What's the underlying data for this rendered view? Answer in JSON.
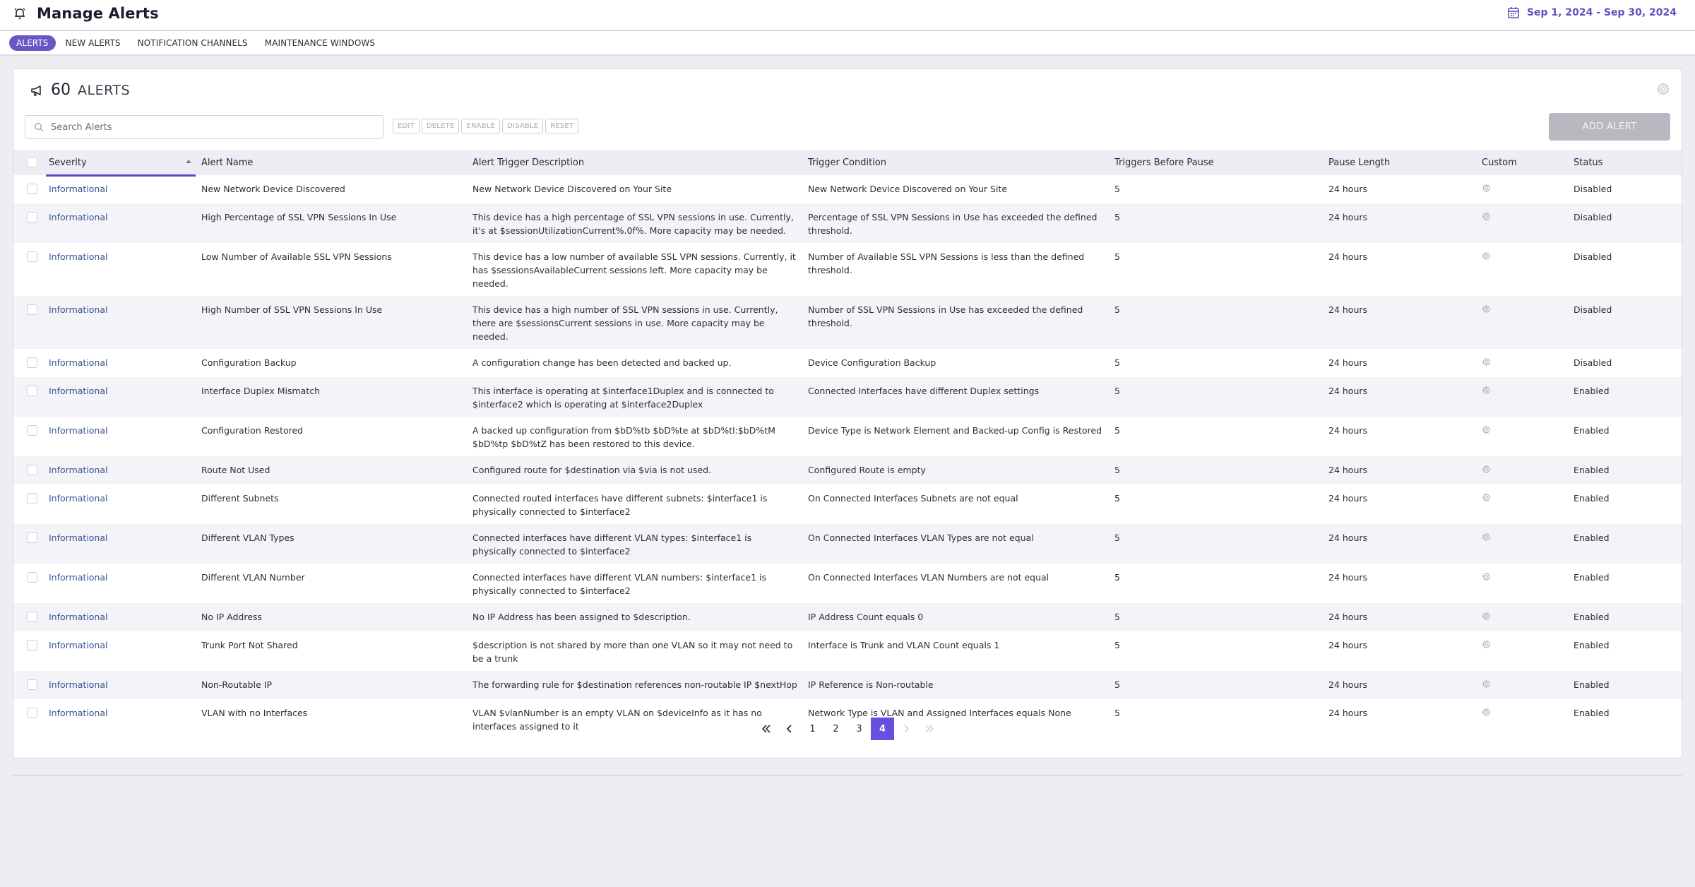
{
  "header": {
    "title": "Manage Alerts",
    "title_icon": "bell-icon",
    "date_range": "Sep 1, 2024 - Sep 30, 2024",
    "date_icon": "calendar-icon"
  },
  "tabs": [
    {
      "label": "ALERTS",
      "active": true
    },
    {
      "label": "NEW ALERTS",
      "active": false
    },
    {
      "label": "NOTIFICATION CHANNELS",
      "active": false
    },
    {
      "label": "MAINTENANCE WINDOWS",
      "active": false
    }
  ],
  "summary": {
    "count": "60",
    "label": "ALERTS",
    "icon": "megaphone-icon"
  },
  "search": {
    "placeholder": "Search Alerts",
    "value": ""
  },
  "actions": {
    "edit": "EDIT",
    "delete": "DELETE",
    "enable": "ENABLE",
    "disable": "DISABLE",
    "reset": "RESET",
    "add_alert": "ADD ALERT"
  },
  "table": {
    "columns": [
      "Severity",
      "Alert Name",
      "Alert Trigger Description",
      "Trigger Condition",
      "Triggers Before Pause",
      "Pause Length",
      "Custom",
      "Status"
    ],
    "sorted_by": "Severity",
    "sort_direction": "ascending",
    "rows": [
      {
        "severity": "Informational",
        "name": "New Network Device Discovered",
        "description": "New Network Device Discovered on Your Site",
        "condition": "New Network Device Discovered on Your Site",
        "triggers": "5",
        "pause": "24 hours",
        "custom": "gear-icon",
        "status": "Disabled"
      },
      {
        "severity": "Informational",
        "name": "High Percentage of SSL VPN Sessions In Use",
        "description": "This device has a high percentage of SSL VPN sessions in use. Currently, it's at $sessionUtilizationCurrent%.0f%. More capacity may be needed.",
        "condition": "Percentage of SSL VPN Sessions in Use has exceeded the defined threshold.",
        "triggers": "5",
        "pause": "24 hours",
        "custom": "gear-icon",
        "status": "Disabled"
      },
      {
        "severity": "Informational",
        "name": "Low Number of Available SSL VPN Sessions",
        "description": "This device has a low number of available SSL VPN sessions. Currently, it has $sessionsAvailableCurrent sessions left. More capacity may be needed.",
        "condition": "Number of Available SSL VPN Sessions is less than the defined threshold.",
        "triggers": "5",
        "pause": "24 hours",
        "custom": "gear-icon",
        "status": "Disabled"
      },
      {
        "severity": "Informational",
        "name": "High Number of SSL VPN Sessions In Use",
        "description": "This device has a high number of SSL VPN sessions in use. Currently, there are $sessionsCurrent sessions in use. More capacity may be needed.",
        "condition": "Number of SSL VPN Sessions in Use has exceeded the defined threshold.",
        "triggers": "5",
        "pause": "24 hours",
        "custom": "gear-icon",
        "status": "Disabled"
      },
      {
        "severity": "Informational",
        "name": "Configuration Backup",
        "description": "A configuration change has been detected and backed up.",
        "condition": "Device Configuration Backup",
        "triggers": "5",
        "pause": "24 hours",
        "custom": "gear-icon",
        "status": "Disabled"
      },
      {
        "severity": "Informational",
        "name": "Interface Duplex Mismatch",
        "description": "This interface is operating at $interface1Duplex and is connected to $interface2 which is operating at $interface2Duplex",
        "condition": "Connected Interfaces have different Duplex settings",
        "triggers": "5",
        "pause": "24 hours",
        "custom": "gear-icon",
        "status": "Enabled"
      },
      {
        "severity": "Informational",
        "name": "Configuration Restored",
        "description": "A backed up configuration from $bD%tb $bD%te at $bD%tl:$bD%tM $bD%tp $bD%tZ has been restored to this device.",
        "condition": "Device Type is Network Element and Backed-up Config is Restored",
        "triggers": "5",
        "pause": "24 hours",
        "custom": "gear-icon",
        "status": "Enabled"
      },
      {
        "severity": "Informational",
        "name": "Route Not Used",
        "description": "Configured route for $destination via $via is not used.",
        "condition": "Configured Route is empty",
        "triggers": "5",
        "pause": "24 hours",
        "custom": "gear-icon",
        "status": "Enabled"
      },
      {
        "severity": "Informational",
        "name": "Different Subnets",
        "description": "Connected routed interfaces have different subnets: $interface1 is physically connected to $interface2",
        "condition": "On Connected Interfaces Subnets are not equal",
        "triggers": "5",
        "pause": "24 hours",
        "custom": "gear-icon",
        "status": "Enabled"
      },
      {
        "severity": "Informational",
        "name": "Different VLAN Types",
        "description": "Connected interfaces have different VLAN types: $interface1 is physically connected to $interface2",
        "condition": "On Connected Interfaces VLAN Types are not equal",
        "triggers": "5",
        "pause": "24 hours",
        "custom": "gear-icon",
        "status": "Enabled"
      },
      {
        "severity": "Informational",
        "name": "Different VLAN Number",
        "description": "Connected interfaces have different VLAN numbers: $interface1 is physically connected to $interface2",
        "condition": "On Connected Interfaces VLAN Numbers are not equal",
        "triggers": "5",
        "pause": "24 hours",
        "custom": "gear-icon",
        "status": "Enabled"
      },
      {
        "severity": "Informational",
        "name": "No IP Address",
        "description": "No IP Address has been assigned to $description.",
        "condition": "IP Address Count equals 0",
        "triggers": "5",
        "pause": "24 hours",
        "custom": "gear-icon",
        "status": "Enabled"
      },
      {
        "severity": "Informational",
        "name": "Trunk Port Not Shared",
        "description": "$description is not shared by more than one VLAN so it may not need to be a trunk",
        "condition": "Interface is Trunk and VLAN Count equals 1",
        "triggers": "5",
        "pause": "24 hours",
        "custom": "gear-icon",
        "status": "Enabled"
      },
      {
        "severity": "Informational",
        "name": "Non-Routable IP",
        "description": "The forwarding rule for $destination references non-routable IP $nextHop",
        "condition": "IP Reference is Non-routable",
        "triggers": "5",
        "pause": "24 hours",
        "custom": "gear-icon",
        "status": "Enabled"
      },
      {
        "severity": "Informational",
        "name": "VLAN with no Interfaces",
        "description": "VLAN $vlanNumber is an empty VLAN on $deviceInfo as it has no interfaces assigned to it",
        "condition": "Network Type is VLAN and Assigned Interfaces equals None",
        "triggers": "5",
        "pause": "24 hours",
        "custom": "gear-icon",
        "status": "Enabled"
      }
    ]
  },
  "pagination": {
    "first": "«",
    "prev": "‹",
    "pages": [
      "1",
      "2",
      "3",
      "4"
    ],
    "current": "4",
    "next": "›",
    "last": "»"
  },
  "colors": {
    "accent": "#6650e0",
    "tab_active": "#6a57c4",
    "date_text": "#5e52c2",
    "severity_link": "#3b5394",
    "add_alert_disabled": "#b9b7c0",
    "page_bg": "#efedf1"
  }
}
